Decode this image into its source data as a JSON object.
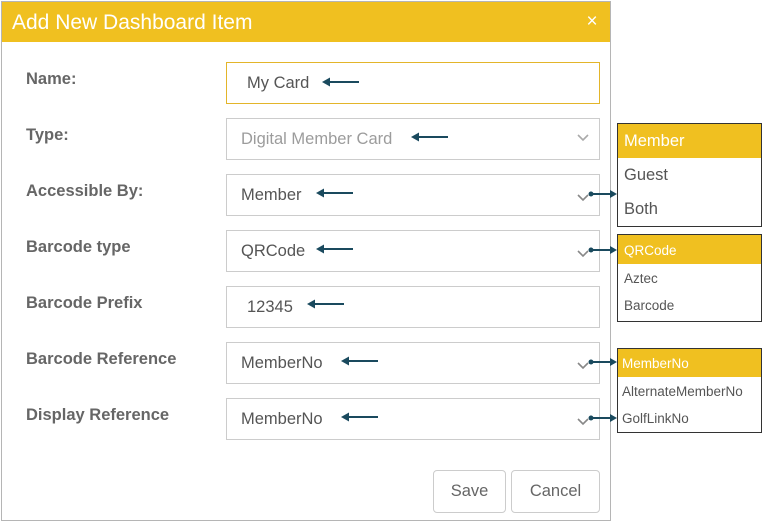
{
  "dialog": {
    "title": "Add New Dashboard Item",
    "close_glyph": "×"
  },
  "form": {
    "name": {
      "label": "Name:",
      "value": "My Card"
    },
    "type": {
      "label": "Type:",
      "value": "Digital Member Card"
    },
    "accessible_by": {
      "label": "Accessible By:",
      "value": "Member"
    },
    "barcode_type": {
      "label": "Barcode type",
      "value": "QRCode"
    },
    "barcode_prefix": {
      "label": "Barcode Prefix",
      "value": "12345"
    },
    "barcode_reference": {
      "label": "Barcode Reference",
      "value": "MemberNo"
    },
    "display_reference": {
      "label": "Display Reference",
      "value": "MemberNo"
    }
  },
  "buttons": {
    "save": "Save",
    "cancel": "Cancel"
  },
  "dropdowns": {
    "accessible_by_options": [
      "Member",
      "Guest",
      "Both"
    ],
    "barcode_type_options": [
      "QRCode",
      "Aztec",
      "Barcode"
    ],
    "reference_options": [
      "MemberNo",
      "AlternateMemberNo",
      "GolfLinkNo"
    ]
  },
  "colors": {
    "accent": "#f0c020",
    "arrow": "#1a4a5e",
    "label": "#666666",
    "border": "#cccccc"
  },
  "icons": {
    "close": "close-icon",
    "chevron": "chevron-down-icon",
    "annotation": "arrow-left-icon"
  }
}
